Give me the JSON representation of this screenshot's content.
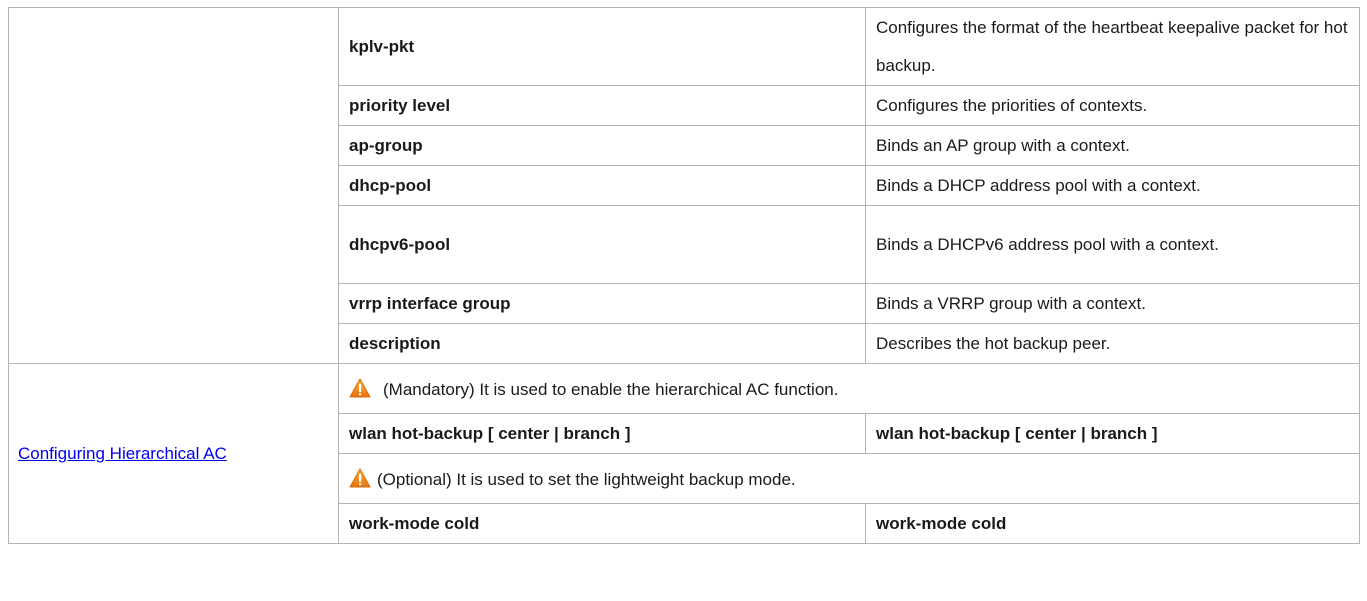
{
  "table": {
    "command_rows": [
      {
        "command": "kplv-pkt",
        "description": "Configures the format of the heartbeat keepalive packet for hot backup."
      },
      {
        "command": "priority level",
        "description": "Configures the priorities of contexts."
      },
      {
        "command": "ap-group",
        "description": "Binds an AP group with a context."
      },
      {
        "command": "dhcp-pool",
        "description": "Binds a DHCP address pool with a context."
      },
      {
        "command": "dhcpv6-pool",
        "description": "Binds a DHCPv6 address pool with a context."
      },
      {
        "command": "vrrp interface group",
        "description": "Binds a VRRP group with a context."
      },
      {
        "command": "description",
        "description": "Describes the hot backup peer."
      }
    ],
    "hierarchical_section": {
      "link_label": "Configuring Hierarchical AC",
      "mandatory_note": "(Mandatory) It is used to enable the hierarchical AC function.",
      "mandatory_command": "wlan hot-backup [ center | branch ]",
      "mandatory_command_right": "wlan hot-backup [ center | branch ]",
      "optional_note": "(Optional) It is used to set the lightweight backup mode.",
      "optional_command": "work-mode cold",
      "optional_command_right": "work-mode cold"
    }
  },
  "icons": {
    "note_icon": "warning-triangle-icon",
    "note_icon_color": "#f39c12"
  }
}
